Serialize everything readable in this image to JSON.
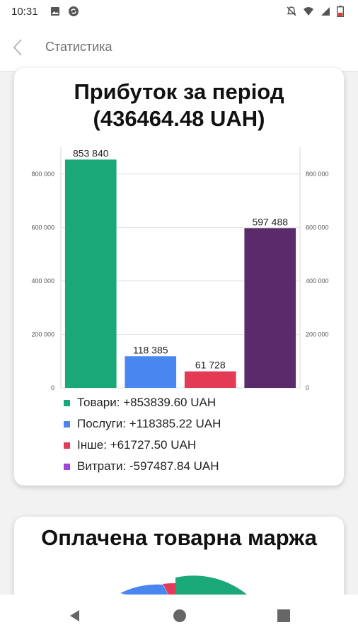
{
  "status_bar": {
    "time": "10:31",
    "icons": [
      "image-icon",
      "sync-icon",
      "notifications-off-icon",
      "wifi-icon",
      "signal-icon",
      "battery-low-icon"
    ]
  },
  "app_bar": {
    "title": "Статистика"
  },
  "profit_card": {
    "title_line1": "Прибуток за період",
    "title_line2": "(436464.48 UAH)"
  },
  "chart_data": {
    "type": "bar",
    "categories": [
      "Товари",
      "Послуги",
      "Інше",
      "Витрати"
    ],
    "values": [
      853840,
      118385,
      61728,
      597488
    ],
    "data_labels": [
      "853 840",
      "118 385",
      "61 728",
      "597 488"
    ],
    "colors": [
      "#1aa878",
      "#4a86f0",
      "#e33a55",
      "#5a2a6b"
    ],
    "ylim": [
      0,
      900000
    ],
    "yticks": [
      0,
      200000,
      400000,
      600000,
      800000
    ],
    "ytick_labels": [
      "0",
      "200 000",
      "400 000",
      "600 000",
      "800 000"
    ],
    "dual_y_axis": true,
    "grid": true,
    "legend_placement": "bottom",
    "legend": [
      {
        "label": "Товари: +853839.60 UAH",
        "color": "#1aa878"
      },
      {
        "label": "Послуги: +118385.22 UAH",
        "color": "#4a86f0"
      },
      {
        "label": "Інше: +61727.50 UAH",
        "color": "#e33a55"
      },
      {
        "label": "Витрати: -597487.84 UAH",
        "color": "#a046d8"
      }
    ]
  },
  "margin_card": {
    "title": "Оплачена товарна маржа"
  },
  "nav_bar": {
    "icons": [
      "back-triangle-icon",
      "home-circle-icon",
      "recents-square-icon"
    ]
  }
}
